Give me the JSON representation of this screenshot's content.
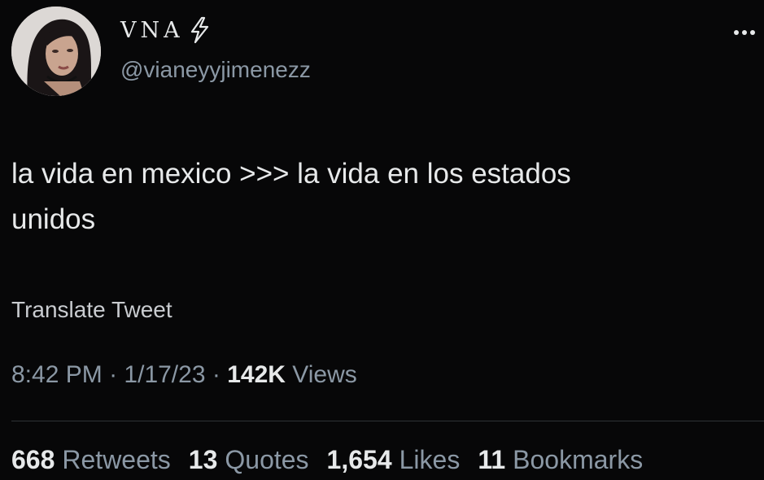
{
  "author": {
    "display_name": "VNA",
    "badge_icon": "lightning-bolt-icon",
    "handle": "@vianeyyjimenezz"
  },
  "tweet": {
    "text": "la vida en mexico >>> la vida en los estados\nunidos",
    "translate_label": "Translate Tweet",
    "time": "8:42 PM",
    "date": "1/17/23",
    "separator": "·",
    "views_count": "142K",
    "views_label": "Views"
  },
  "stats": [
    {
      "count": "668",
      "label": "Retweets"
    },
    {
      "count": "13",
      "label": "Quotes"
    },
    {
      "count": "1,654",
      "label": "Likes"
    },
    {
      "count": "11",
      "label": "Bookmarks"
    }
  ],
  "colors": {
    "background": "#070708",
    "primary_text": "#e7e9ea",
    "secondary_text": "#8b98a5",
    "divider": "#2f3336"
  }
}
